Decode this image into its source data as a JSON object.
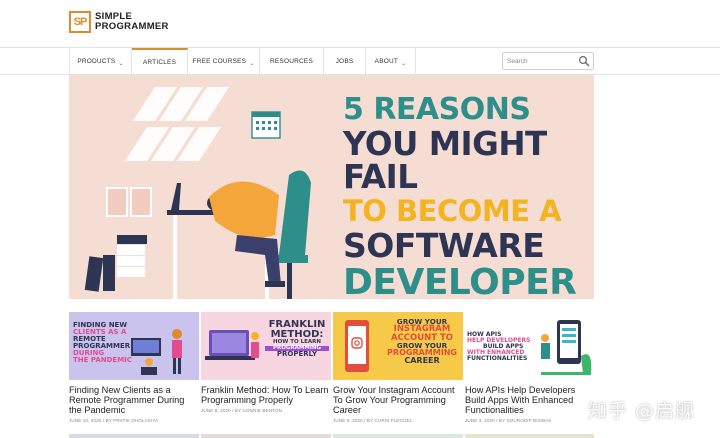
{
  "logo": {
    "mark": "SP",
    "line1": "SIMPLE",
    "line2": "PROGRAMMER"
  },
  "nav": {
    "items": [
      {
        "label": "PRODUCTS",
        "has_dropdown": true
      },
      {
        "label": "ARTICLES",
        "has_dropdown": false,
        "active": true
      },
      {
        "label": "FREE COURSES",
        "has_dropdown": true
      },
      {
        "label": "RESOURCES",
        "has_dropdown": false
      },
      {
        "label": "JOBS",
        "has_dropdown": false
      },
      {
        "label": "ABOUT",
        "has_dropdown": true
      }
    ],
    "chevron": "⌄"
  },
  "search": {
    "placeholder": "Search",
    "icon": "search-icon"
  },
  "hero": {
    "lines": [
      "5 REASONS",
      "YOU MIGHT FAIL",
      "TO BECOME A",
      "SOFTWARE",
      "DEVELOPER"
    ]
  },
  "cards": [
    {
      "thumb_lines": [
        "FINDING NEW",
        "CLIENTS AS A",
        "REMOTE",
        "PROGRAMMER",
        "DURING",
        "THE PANDEMIC"
      ],
      "title": "Finding New Clients as a Remote Programmer During the Pandemic",
      "meta": "JUNE 10, 2020 / BY PRATIK DHOLAKIYA"
    },
    {
      "thumb_lines": [
        "FRANKLIN",
        "METHOD:",
        "HOW TO LEARN",
        "PROGRAMMING",
        "PROPERLY"
      ],
      "title": "Franklin Method: How To Learn Programming Properly",
      "meta": "JUNE 8, 2020 / BY CONNIE BENTON"
    },
    {
      "thumb_lines": [
        "GROW YOUR",
        "INSTAGRAM",
        "ACCOUNT TO",
        "GROW YOUR",
        "PROGRAMMING",
        "CAREER"
      ],
      "title": "Grow Your Instagram Account To Grow Your Programming Career",
      "meta": "JUNE 5, 2020 / BY CHRIS FLEGUEL"
    },
    {
      "thumb_lines": [
        "HOW APIS",
        "HELP DEVELOPERS",
        "BUILD APPS",
        "WITH ENHANCED",
        "FUNCTIONALITIES"
      ],
      "title": "How APIs Help Developers Build Apps With Enhanced Functionalities",
      "meta": "JUNE 3, 2020 / BY SOURODIP BISWAS"
    }
  ],
  "watermark": "知乎 @启舰",
  "colors": {
    "accent": "#e08a2c",
    "teal": "#2e8f8a",
    "navy": "#2e3552",
    "yellow": "#f4b321",
    "hero_bg": "#f6ddd3"
  }
}
